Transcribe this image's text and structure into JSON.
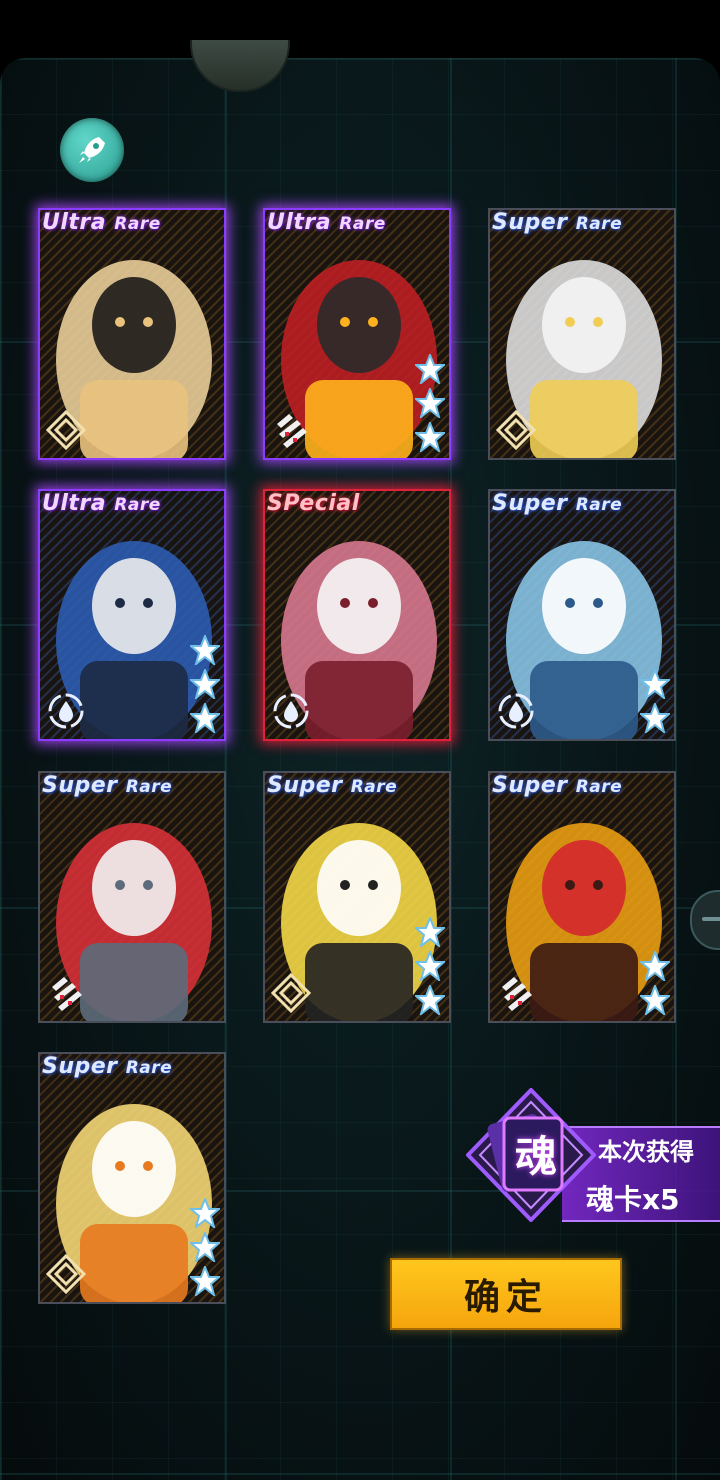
{
  "cards": [
    {
      "rarity_main": "Ultra",
      "rarity_sub": "Rare",
      "tier": "ur",
      "stars": 0,
      "role": "diamond-role-icon",
      "subject": "blonde-girl"
    },
    {
      "rarity_main": "Ultra",
      "rarity_sub": "Rare",
      "tier": "ur",
      "stars": 3,
      "role": "claw-role-icon",
      "subject": "red-mech"
    },
    {
      "rarity_main": "Super",
      "rarity_sub": "Rare",
      "tier": "sr",
      "stars": 0,
      "role": "diamond-role-icon",
      "subject": "silver-hair-girl"
    },
    {
      "rarity_main": "Ultra",
      "rarity_sub": "Rare",
      "tier": "ur",
      "stars": 3,
      "role": "drop-role-icon",
      "subject": "blue-mech"
    },
    {
      "rarity_main": "SPecial",
      "rarity_sub": "",
      "tier": "sp",
      "stars": 0,
      "role": "drop-role-icon",
      "subject": "pink-hair-swordswoman"
    },
    {
      "rarity_main": "Super",
      "rarity_sub": "Rare",
      "tier": "sr",
      "stars": 2,
      "role": "drop-role-icon",
      "subject": "chibi-blue-hair"
    },
    {
      "rarity_main": "Super",
      "rarity_sub": "Rare",
      "tier": "sr",
      "stars": 0,
      "role": "claw-role-icon",
      "subject": "red-twintail-girl"
    },
    {
      "rarity_main": "Super",
      "rarity_sub": "Rare",
      "tier": "sr",
      "stars": 3,
      "role": "diamond-role-icon",
      "subject": "chibi-yellow-helmet"
    },
    {
      "rarity_main": "Super",
      "rarity_sub": "Rare",
      "tier": "sr",
      "stars": 2,
      "role": "claw-role-icon",
      "subject": "skull-bell-robot"
    },
    {
      "rarity_main": "Super",
      "rarity_sub": "Rare",
      "tier": "sr",
      "stars": 3,
      "role": "diamond-role-icon",
      "subject": "chibi-glasses-blonde"
    }
  ],
  "reward": {
    "soul_char": "魂",
    "title": "本次获得",
    "count": "魂卡x5"
  },
  "confirm_label": "确定",
  "icons": {
    "top_left": "rocket-icon",
    "side": "minus-icon"
  },
  "colors": {
    "ultra_rare_glow": "#8b3cff",
    "special_glow": "#e0213a",
    "confirm_bg": "#ffc81e",
    "rocket_bg": "#2a9d91"
  }
}
